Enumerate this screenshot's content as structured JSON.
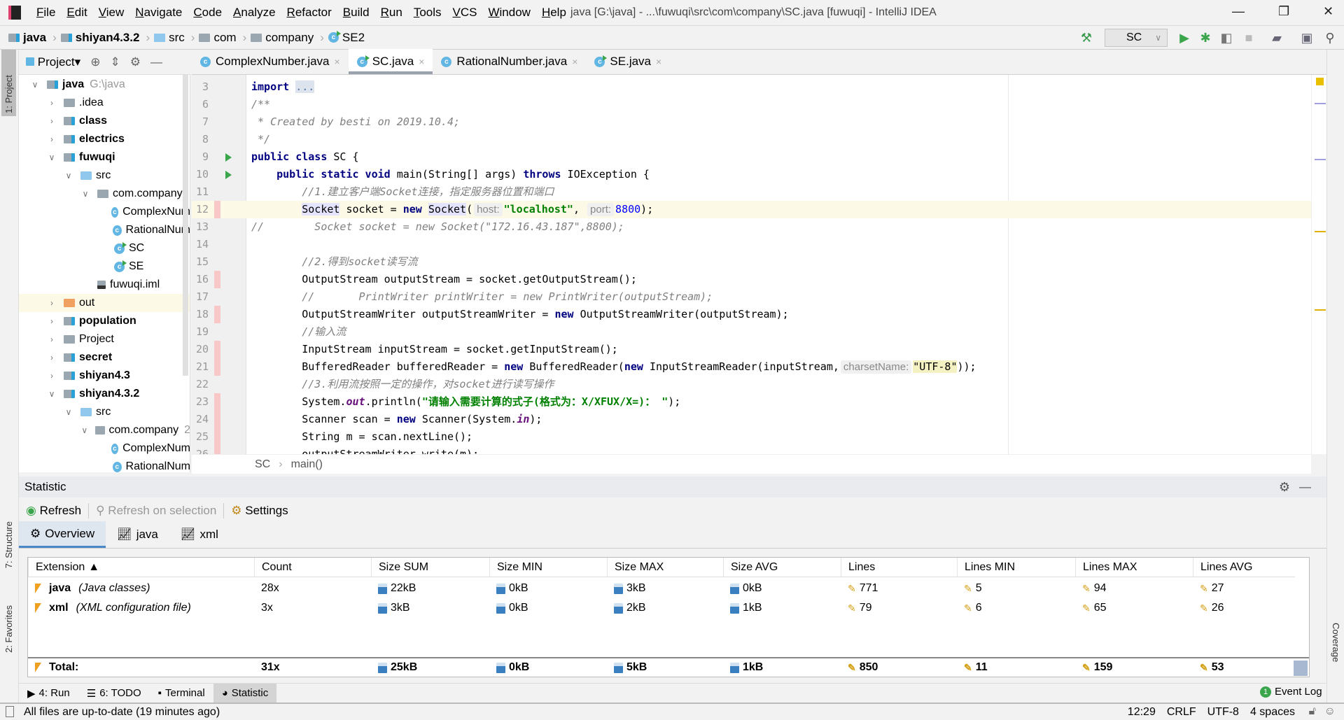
{
  "window": {
    "title": "java [G:\\java] - ...\\fuwuqi\\src\\com\\company\\SC.java [fuwuqi] - IntelliJ IDEA",
    "menu": [
      "File",
      "Edit",
      "View",
      "Navigate",
      "Code",
      "Analyze",
      "Refactor",
      "Build",
      "Run",
      "Tools",
      "VCS",
      "Window",
      "Help"
    ]
  },
  "navbar": {
    "crumbs": [
      "java",
      "shiyan4.3.2",
      "src",
      "com",
      "company",
      "SE2"
    ],
    "run_config": "SC"
  },
  "left_strip": {
    "project": "1: Project",
    "structure": "7: Structure",
    "favorites": "2: Favorites"
  },
  "right_strip": {
    "coverage": "Coverage"
  },
  "project": {
    "title": "Project",
    "tree": [
      {
        "label": "java",
        "hint": "G:\\java",
        "bold": true,
        "depth": 0,
        "open": true,
        "icon": "module-folder"
      },
      {
        "label": ".idea",
        "depth": 1,
        "open": false,
        "icon": "folder"
      },
      {
        "label": "class",
        "bold": true,
        "depth": 1,
        "open": false,
        "icon": "module-folder"
      },
      {
        "label": "electrics",
        "bold": true,
        "depth": 1,
        "open": false,
        "icon": "module-folder"
      },
      {
        "label": "fuwuqi",
        "bold": true,
        "depth": 1,
        "open": true,
        "icon": "module-folder"
      },
      {
        "label": "src",
        "depth": 2,
        "open": true,
        "icon": "source-folder"
      },
      {
        "label": "com.company",
        "depth": 3,
        "open": true,
        "icon": "package"
      },
      {
        "label": "ComplexNum",
        "depth": 4,
        "icon": "class"
      },
      {
        "label": "RationalNum",
        "depth": 4,
        "icon": "class"
      },
      {
        "label": "SC",
        "depth": 4,
        "icon": "run-class"
      },
      {
        "label": "SE",
        "depth": 4,
        "icon": "run-class"
      },
      {
        "label": "fuwuqi.iml",
        "depth": 3,
        "icon": "iml-file"
      },
      {
        "label": "out",
        "depth": 1,
        "open": false,
        "icon": "excluded-folder",
        "highlight": true
      },
      {
        "label": "population",
        "bold": true,
        "depth": 1,
        "open": false,
        "icon": "module-folder"
      },
      {
        "label": "Project",
        "depth": 1,
        "open": false,
        "icon": "folder"
      },
      {
        "label": "secret",
        "bold": true,
        "depth": 1,
        "open": false,
        "icon": "module-folder"
      },
      {
        "label": "shiyan4.3",
        "bold": true,
        "depth": 1,
        "open": false,
        "icon": "module-folder"
      },
      {
        "label": "shiyan4.3.2",
        "bold": true,
        "depth": 1,
        "open": true,
        "icon": "module-folder"
      },
      {
        "label": "src",
        "depth": 2,
        "open": true,
        "icon": "source-folder"
      },
      {
        "label": "com.company",
        "hint": "2",
        "depth": 3,
        "open": true,
        "icon": "package"
      },
      {
        "label": "ComplexNum",
        "depth": 4,
        "icon": "class"
      },
      {
        "label": "RationalNum",
        "depth": 4,
        "icon": "class"
      }
    ]
  },
  "editor": {
    "tabs": [
      {
        "label": "ComplexNumber.java",
        "icon": "class"
      },
      {
        "label": "SC.java",
        "icon": "run-class",
        "active": true
      },
      {
        "label": "RationalNumber.java",
        "icon": "class"
      },
      {
        "label": "SE.java",
        "icon": "run-class"
      }
    ],
    "breadcrumb": [
      "SC",
      "main()"
    ],
    "lines": [
      {
        "n": "3",
        "t": [
          [
            "k",
            "import"
          ],
          [
            "p",
            " "
          ],
          [
            "f",
            "..."
          ]
        ]
      },
      {
        "n": "6",
        "t": [
          [
            "c",
            "/**"
          ]
        ]
      },
      {
        "n": "7",
        "t": [
          [
            "c",
            " * Created by besti on 2019.10.4;"
          ]
        ]
      },
      {
        "n": "8",
        "t": [
          [
            "c",
            " */"
          ]
        ]
      },
      {
        "n": "9",
        "run": true,
        "t": [
          [
            "k",
            "public class"
          ],
          [
            "p",
            " SC {"
          ]
        ]
      },
      {
        "n": "10",
        "run": true,
        "t": [
          [
            "p",
            "    "
          ],
          [
            "k",
            "public static void"
          ],
          [
            "p",
            " main(String[] args) "
          ],
          [
            "k",
            "throws"
          ],
          [
            "p",
            " IOException {"
          ]
        ]
      },
      {
        "n": "11",
        "t": [
          [
            "c",
            "        //1.建立客户端Socket连接，指定服务器位置和端口"
          ]
        ]
      },
      {
        "n": "12",
        "cur": true,
        "mark": true,
        "t": [
          [
            "p",
            "        "
          ],
          [
            "sel",
            "Socket"
          ],
          [
            "p",
            " socket = "
          ],
          [
            "k",
            "new"
          ],
          [
            "p",
            " "
          ],
          [
            "sel",
            "Socket"
          ],
          [
            "p",
            "("
          ],
          [
            "h",
            "host:"
          ],
          [
            "s",
            "\"localhost\""
          ],
          [
            "p",
            ", "
          ],
          [
            "h",
            "port:"
          ],
          [
            "n",
            "8800"
          ],
          [
            "p",
            ");"
          ]
        ]
      },
      {
        "n": "13",
        "t": [
          [
            "c",
            "//        Socket socket = new Socket(\"172.16.43.187\",8800);"
          ]
        ]
      },
      {
        "n": "14",
        "t": []
      },
      {
        "n": "15",
        "t": [
          [
            "c",
            "        //2.得到socket读写流"
          ]
        ]
      },
      {
        "n": "16",
        "mark": true,
        "t": [
          [
            "p",
            "        OutputStream outputStream = socket.getOutputStream();"
          ]
        ]
      },
      {
        "n": "17",
        "t": [
          [
            "c",
            "        //       PrintWriter printWriter = new PrintWriter(outputStream);"
          ]
        ]
      },
      {
        "n": "18",
        "mark": true,
        "t": [
          [
            "p",
            "        OutputStreamWriter outputStreamWriter = "
          ],
          [
            "k",
            "new"
          ],
          [
            "p",
            " OutputStreamWriter(outputStream);"
          ]
        ]
      },
      {
        "n": "19",
        "t": [
          [
            "c",
            "        //输入流"
          ]
        ]
      },
      {
        "n": "20",
        "mark": true,
        "t": [
          [
            "p",
            "        InputStream inputStream = socket.getInputStream();"
          ]
        ]
      },
      {
        "n": "21",
        "mark": true,
        "t": [
          [
            "p",
            "        BufferedReader bufferedReader = "
          ],
          [
            "k",
            "new"
          ],
          [
            "p",
            " BufferedReader("
          ],
          [
            "k",
            "new"
          ],
          [
            "p",
            " InputStreamReader(inputStream,"
          ],
          [
            "h",
            "charsetName:"
          ],
          [
            "sh",
            "\"UTF-8\""
          ],
          [
            "p",
            "));"
          ]
        ]
      },
      {
        "n": "22",
        "t": [
          [
            "c",
            "        //3.利用流按照一定的操作，对socket进行读写操作"
          ]
        ]
      },
      {
        "n": "23",
        "mark": true,
        "t": [
          [
            "p",
            "        System."
          ],
          [
            "ki",
            "out"
          ],
          [
            "p",
            ".println("
          ],
          [
            "s",
            "\"请输入需要计算的式子(格式为：X/XFUX/X=)： \""
          ],
          [
            "p",
            ");"
          ]
        ]
      },
      {
        "n": "24",
        "mark": true,
        "t": [
          [
            "p",
            "        Scanner scan = "
          ],
          [
            "k",
            "new"
          ],
          [
            "p",
            " Scanner(System."
          ],
          [
            "ki",
            "in"
          ],
          [
            "p",
            ");"
          ]
        ]
      },
      {
        "n": "25",
        "mark": true,
        "t": [
          [
            "p",
            "        String m = scan.nextLine();"
          ]
        ]
      },
      {
        "n": "26",
        "mark": true,
        "t": [
          [
            "p",
            "        outputStreamWriter.write(m);"
          ]
        ]
      }
    ]
  },
  "statistic": {
    "title": "Statistic",
    "toolbar": {
      "refresh": "Refresh",
      "refresh_sel": "Refresh on selection",
      "settings": "Settings"
    },
    "tabs": [
      "Overview",
      "java",
      "xml"
    ],
    "columns": [
      "Extension",
      "Count",
      "Size SUM",
      "Size MIN",
      "Size MAX",
      "Size AVG",
      "Lines",
      "Lines MIN",
      "Lines MAX",
      "Lines AVG"
    ],
    "sort_indicator": "▲",
    "rows": [
      {
        "ext": "java",
        "desc": "(Java classes)",
        "values": [
          "28x",
          "22kB",
          "0kB",
          "3kB",
          "0kB",
          "771",
          "5",
          "94",
          "27"
        ]
      },
      {
        "ext": "xml",
        "desc": "(XML configuration file)",
        "values": [
          "3x",
          "3kB",
          "0kB",
          "2kB",
          "1kB",
          "79",
          "6",
          "65",
          "26"
        ]
      }
    ],
    "total": {
      "label": "Total:",
      "values": [
        "31x",
        "25kB",
        "0kB",
        "5kB",
        "1kB",
        "850",
        "11",
        "159",
        "53"
      ]
    }
  },
  "bottom_tabs": [
    {
      "label": "4: Run",
      "icon": "run-icon"
    },
    {
      "label": "6: TODO",
      "icon": "todo-icon"
    },
    {
      "label": "Terminal",
      "icon": "terminal-icon"
    },
    {
      "label": "Statistic",
      "icon": "statistic-icon",
      "active": true
    }
  ],
  "event_log": {
    "label": "Event Log",
    "count": "1"
  },
  "status": {
    "message": "All files are up-to-date (19 minutes ago)",
    "position": "12:29",
    "line_sep": "CRLF",
    "encoding": "UTF-8",
    "indent": "4 spaces"
  },
  "colors": {
    "keyword": "#000080",
    "string": "#008000",
    "comment": "#808080",
    "number": "#0000ff",
    "current_line": "#fcfae6",
    "accent": "#4a86c8"
  }
}
